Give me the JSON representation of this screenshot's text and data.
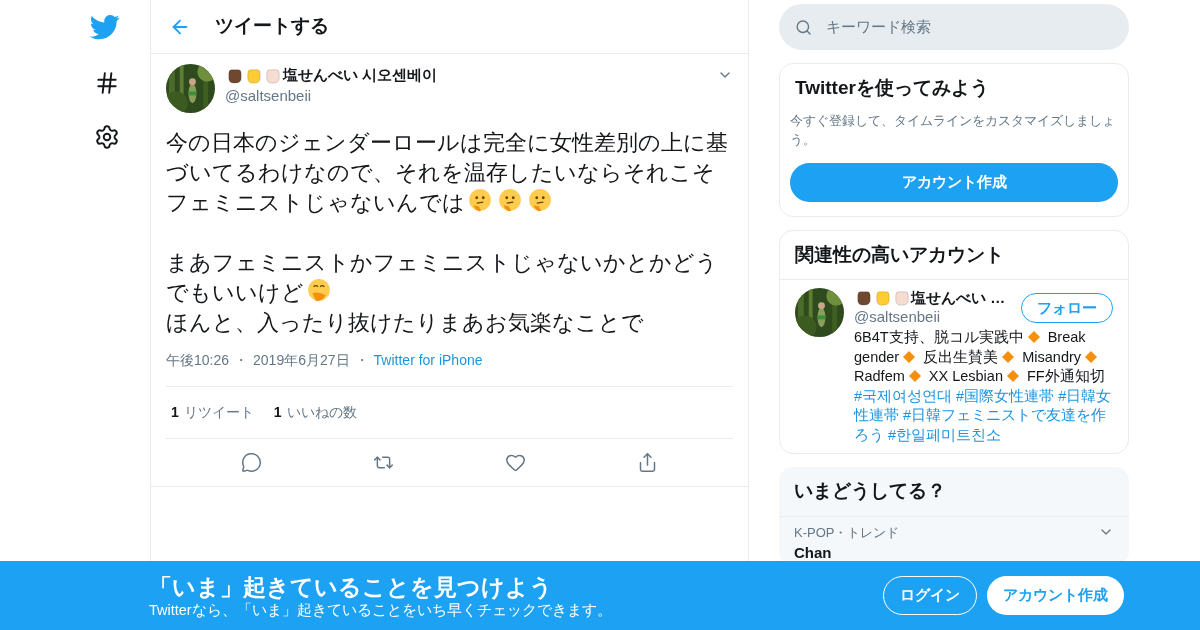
{
  "nav": [
    {
      "kind": "logo"
    },
    {
      "kind": "explore"
    },
    {
      "kind": "settings"
    }
  ],
  "header": {
    "title": "ツイートする"
  },
  "tweet": {
    "author": {
      "fists": [
        {
          "color": "#70482f"
        },
        {
          "color": "#ffcc33"
        },
        {
          "color": "#f7dcd2"
        }
      ],
      "name": "塩せんべい 시오센베이",
      "handle": "@saltsenbeii"
    },
    "body": [
      {
        "kind": "text",
        "text": "今の日本のジェンダーロールは完全に女性差別の上に基づいてるわけなので、それを温存したいならそれこそフェミニストじゃないんでは"
      },
      {
        "kind": "thinking"
      },
      {
        "kind": "thinking"
      },
      {
        "kind": "thinking"
      },
      {
        "kind": "text",
        "text": "\n\nまあフェミニストかフェミニストじゃないかとかどうでもいいけど"
      },
      {
        "kind": "giggle"
      },
      {
        "kind": "text",
        "text": "\nほんと、入ったり抜けたりまあお気楽なことで"
      }
    ],
    "meta": [
      {
        "kind": "time",
        "text": "午後10:26"
      },
      {
        "kind": "separator",
        "text": "・"
      },
      {
        "kind": "date",
        "text": "2019年6月27日"
      },
      {
        "kind": "separator",
        "text": "・"
      },
      {
        "kind": "source",
        "text": "Twitter for iPhone"
      }
    ],
    "stats": [
      {
        "count": "1",
        "label": "リツイート"
      },
      {
        "count": "1",
        "label": "いいねの数"
      }
    ],
    "actions": [
      {
        "kind": "reply"
      },
      {
        "kind": "retweet"
      },
      {
        "kind": "like"
      },
      {
        "kind": "share"
      }
    ]
  },
  "search": {
    "placeholder": "キーワード検索"
  },
  "signup_card": {
    "title": "Twitterを使ってみよう",
    "text": "今すぐ登録して、タイムラインをカスタマイズしましょう。",
    "button": "アカウント作成"
  },
  "related": {
    "title": "関連性の高いアカウント",
    "account": {
      "fists": [
        {
          "color": "#70482f"
        },
        {
          "color": "#ffcc33"
        },
        {
          "color": "#f7dcd2"
        }
      ],
      "name": "塩せんべい …",
      "handle": "@saltsenbeii",
      "follow": "フォロー",
      "bio": [
        {
          "kind": "text",
          "text": "6B4T支持、脱コル実践中"
        },
        {
          "kind": "diamond"
        },
        {
          "kind": "text",
          "text": "Break gender"
        },
        {
          "kind": "diamond"
        },
        {
          "kind": "text",
          "text": "反出生賛美"
        },
        {
          "kind": "diamond"
        },
        {
          "kind": "text",
          "text": "Misandry"
        },
        {
          "kind": "diamond"
        },
        {
          "kind": "text",
          "text": "Radfem"
        },
        {
          "kind": "diamond"
        },
        {
          "kind": "text",
          "text": "XX Lesbian"
        },
        {
          "kind": "diamond"
        },
        {
          "kind": "text",
          "text": "FF外通知切"
        },
        {
          "kind": "link",
          "text": "#국제여성연대"
        },
        {
          "kind": "link",
          "text": "#国際女性連帯"
        },
        {
          "kind": "link",
          "text": "#日韓女性連帯"
        },
        {
          "kind": "link",
          "text": "#日韓フェミニストで友達を作ろう"
        },
        {
          "kind": "link",
          "text": "#한일페미트친소"
        }
      ]
    }
  },
  "trends": {
    "title": "いまどうしてる？",
    "items": [
      {
        "context": "K-POP・トレンド",
        "name": "Chan"
      }
    ]
  },
  "banner": {
    "title": "「いま」起きていることを見つけよう",
    "subtitle": "Twitterなら、「いま」起きていることをいち早くチェックできます。",
    "login": "ログイン",
    "signup": "アカウント作成"
  }
}
